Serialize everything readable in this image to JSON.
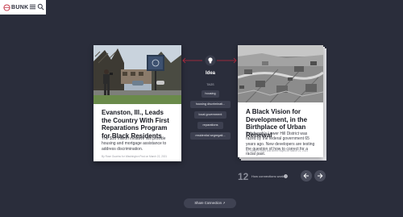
{
  "brand": {
    "name": "BUNK"
  },
  "icons": {
    "menu": "hamburger-menu-icon",
    "search": "search-icon",
    "lightbulb": "lightbulb-icon"
  },
  "colors": {
    "background": "#2a2d3b",
    "accent": "#c0283c",
    "card": "#ffffff"
  },
  "left_card": {
    "title": "Evanston, Ill., Leads the Country With First Reparations Program for Black Residents",
    "description": "The $10 million initiative will provide housing and mortgage assistance to address discrimination.",
    "byline": "By Rose Guarino for Washington Post on March 22, 2021"
  },
  "connection": {
    "idea": "Idea",
    "tags_label": "TAGS",
    "tags": [
      "housing",
      "housing discriminati...",
      "local government",
      "reparations",
      "residential segregati..."
    ]
  },
  "right_card": {
    "title": "A Black Vision for Development, in the Birthplace of Urban Renewal",
    "description": "Pittsburgh's Lower Hill District was razed by the federal government 65 years ago. New developers are testing the question of how to correct for a racial past.",
    "byline": "By Brandon Ward and Brent Hayes on March 21, 2021"
  },
  "pager": {
    "count": "12",
    "label": "How connections work"
  },
  "share_button": "Share Connection ↗"
}
